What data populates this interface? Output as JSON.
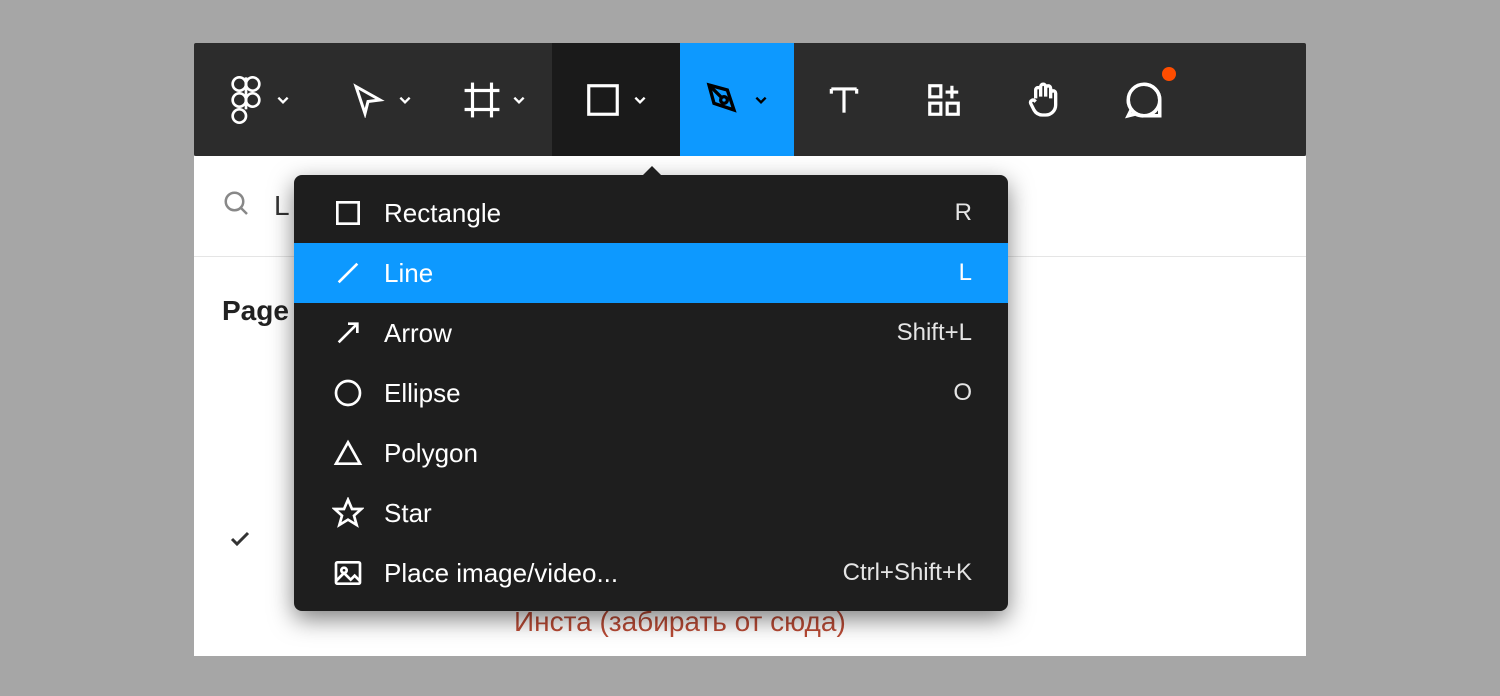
{
  "toolbar": {
    "items": [
      {
        "name": "figma-menu",
        "icon": "figma",
        "hasChevron": true,
        "state": "normal"
      },
      {
        "name": "move-tool",
        "icon": "cursor",
        "hasChevron": true,
        "state": "normal"
      },
      {
        "name": "frame-tool",
        "icon": "frame",
        "hasChevron": true,
        "state": "normal"
      },
      {
        "name": "shape-tool",
        "icon": "rectangle",
        "hasChevron": true,
        "state": "darker"
      },
      {
        "name": "pen-tool",
        "icon": "pen",
        "hasChevron": true,
        "state": "active"
      },
      {
        "name": "text-tool",
        "icon": "text",
        "hasChevron": false,
        "state": "normal"
      },
      {
        "name": "resources-tool",
        "icon": "resources",
        "hasChevron": false,
        "state": "normal"
      },
      {
        "name": "hand-tool",
        "icon": "hand",
        "hasChevron": false,
        "state": "normal"
      },
      {
        "name": "comment-tool",
        "icon": "comment",
        "hasChevron": false,
        "state": "normal",
        "badge": true
      }
    ]
  },
  "sidebar": {
    "search_placeholder": "L",
    "pages_label": "Page",
    "layer_text": "Инста (забирать от сюда)"
  },
  "dropdown": {
    "items": [
      {
        "icon": "rectangle",
        "label": "Rectangle",
        "shortcut": "R",
        "selected": false
      },
      {
        "icon": "line",
        "label": "Line",
        "shortcut": "L",
        "selected": true
      },
      {
        "icon": "arrow",
        "label": "Arrow",
        "shortcut": "Shift+L",
        "selected": false
      },
      {
        "icon": "ellipse",
        "label": "Ellipse",
        "shortcut": "O",
        "selected": false
      },
      {
        "icon": "polygon",
        "label": "Polygon",
        "shortcut": "",
        "selected": false
      },
      {
        "icon": "star",
        "label": "Star",
        "shortcut": "",
        "selected": false
      },
      {
        "icon": "image",
        "label": "Place image/video...",
        "shortcut": "Ctrl+Shift+K",
        "selected": false
      }
    ]
  }
}
